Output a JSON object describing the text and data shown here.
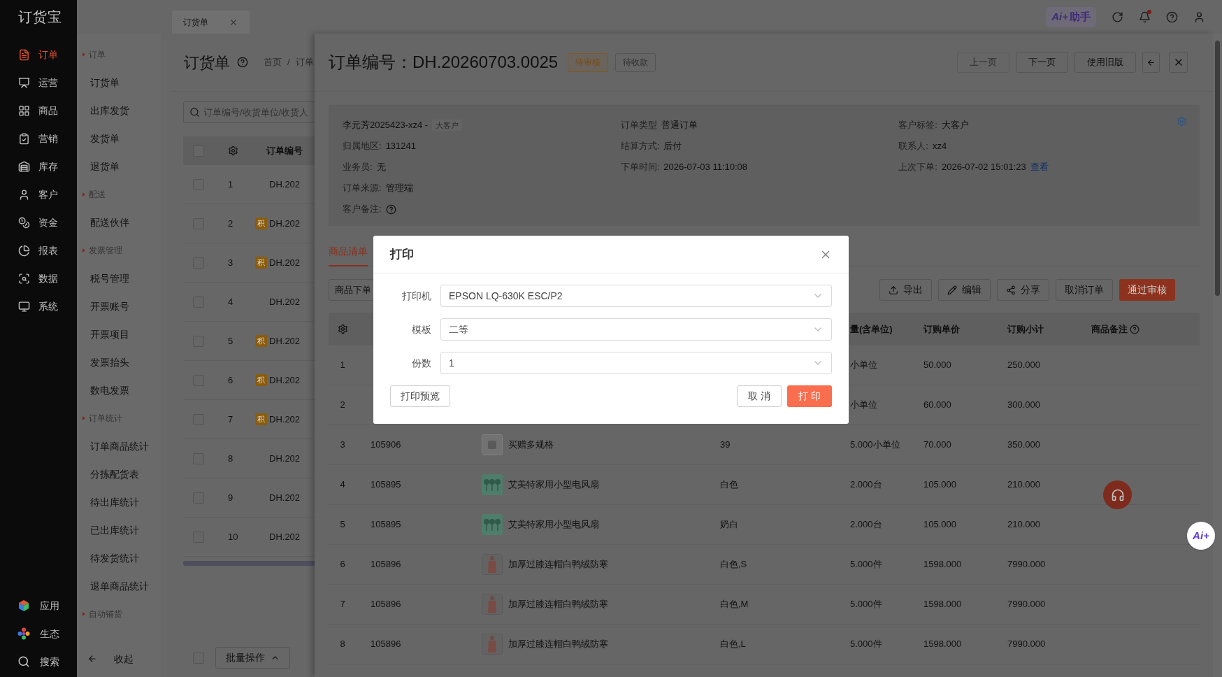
{
  "sidebar": {
    "logo": "订货宝",
    "items": [
      {
        "label": "订单",
        "selected": true
      },
      {
        "label": "运营",
        "selected": false
      },
      {
        "label": "商品",
        "selected": false
      },
      {
        "label": "营销",
        "selected": false
      },
      {
        "label": "库存",
        "selected": false
      },
      {
        "label": "客户",
        "selected": false
      },
      {
        "label": "资金",
        "selected": false
      },
      {
        "label": "报表",
        "selected": false
      },
      {
        "label": "数据",
        "selected": false
      },
      {
        "label": "系统",
        "selected": false
      }
    ],
    "bottom_items": [
      {
        "label": "应用"
      },
      {
        "label": "生态"
      },
      {
        "label": "搜索"
      }
    ]
  },
  "submenu": {
    "items": [
      {
        "kind": "group",
        "label": "订单"
      },
      {
        "kind": "link",
        "label": "订货单"
      },
      {
        "kind": "link",
        "label": "出库发货"
      },
      {
        "kind": "link",
        "label": "发货单"
      },
      {
        "kind": "link",
        "label": "退货单"
      },
      {
        "kind": "group",
        "label": "配送"
      },
      {
        "kind": "link",
        "label": "配送伙伴"
      },
      {
        "kind": "group",
        "label": "发票管理"
      },
      {
        "kind": "link",
        "label": "税号管理"
      },
      {
        "kind": "link",
        "label": "开票账号"
      },
      {
        "kind": "link",
        "label": "开票项目"
      },
      {
        "kind": "link",
        "label": "发票抬头"
      },
      {
        "kind": "link",
        "label": "数电发票"
      },
      {
        "kind": "group",
        "label": "订单统计"
      },
      {
        "kind": "link",
        "label": "订单商品统计"
      },
      {
        "kind": "link",
        "label": "分拣配货表"
      },
      {
        "kind": "link",
        "label": "待出库统计"
      },
      {
        "kind": "link",
        "label": "已出库统计"
      },
      {
        "kind": "link",
        "label": "待发货统计"
      },
      {
        "kind": "link",
        "label": "退单商品统计"
      },
      {
        "kind": "group",
        "label": "自动铺货"
      }
    ],
    "collapse": "收起"
  },
  "topbar": {
    "tabs": [
      {
        "label": "订货单",
        "selected": true
      }
    ],
    "assistant": {
      "logo": "Ai+",
      "label": "助手"
    },
    "notifications": {
      "unread": true
    }
  },
  "list_page": {
    "title": "订货单",
    "breadcrumb": {
      "items": [
        "首页",
        "订单"
      ],
      "separator": "/"
    },
    "search": {
      "placeholder": "订单编号/收货单位/收货人"
    },
    "header_checked": false,
    "column": "订单编号",
    "rows": [
      {
        "index": "1",
        "order": "DH.202",
        "checked": false
      },
      {
        "index": "2",
        "badge": "积",
        "order": "DH.202",
        "checked": false
      },
      {
        "index": "3",
        "badge": "积",
        "order": "DH.202",
        "checked": false
      },
      {
        "index": "4",
        "order": "DH.202",
        "checked": false
      },
      {
        "index": "5",
        "badge": "积",
        "order": "DH.202",
        "checked": false
      },
      {
        "index": "6",
        "badge": "积",
        "order": "DH.202",
        "checked": false
      },
      {
        "index": "7",
        "badge": "积",
        "order": "DH.202",
        "checked": false
      },
      {
        "index": "8",
        "order": "DH.202",
        "checked": false
      },
      {
        "index": "9",
        "order": "DH.202",
        "checked": false
      },
      {
        "index": "10",
        "order": "DH.202",
        "checked": false
      }
    ],
    "footer_checked": false,
    "batch": "批量操作"
  },
  "drawer": {
    "title": "订单编号：DH.20260703.0025",
    "tags": [
      {
        "label": "待审核",
        "kind": "warning"
      },
      {
        "label": "待收款",
        "kind": "plain"
      }
    ],
    "nav": [
      {
        "label": "上一页",
        "disabled": true
      },
      {
        "label": "下一页",
        "disabled": false
      },
      {
        "label": "使用旧版",
        "disabled": false
      }
    ],
    "customer": {
      "name": "李元芳2025423-xz4 -",
      "tag": "大客户"
    },
    "info_columns": [
      [
        {
          "label": "归属地区:",
          "value": "131241"
        },
        {
          "label": "业务员:",
          "value": "无"
        },
        {
          "label": "订单来源:",
          "value": "管理端"
        },
        {
          "label": "客户备注:",
          "kind": "help"
        }
      ],
      [
        {
          "label": "订单类型",
          "value": "普通订单"
        },
        {
          "label": "结算方式:",
          "value": "后付"
        },
        {
          "label": "下单时间:",
          "value": "2026-07-03 11:10:08"
        }
      ],
      [
        {
          "label": "客户标签:",
          "value": "大客户"
        },
        {
          "label": "联系人:",
          "value": "xz4"
        },
        {
          "label": "上次下单:",
          "value": "2026-07-02 15:01:23",
          "link": "查看"
        }
      ]
    ],
    "tabs": [
      {
        "label": "商品清单",
        "selected": true
      }
    ],
    "toolbar": [
      {
        "label": "商品下单",
        "kind": "plain"
      },
      {
        "label": "导出",
        "kind": "export"
      },
      {
        "label": "编辑",
        "kind": "edit"
      },
      {
        "label": "分享",
        "kind": "share"
      },
      {
        "label": "取消订单",
        "kind": "plain"
      },
      {
        "label": "通过审核",
        "kind": "primary"
      }
    ],
    "columns": {
      "quantity": "量(含单位)",
      "price": "订购单价",
      "subtotal": "订购小计",
      "note": "商品备注"
    },
    "rows": [
      {
        "index": "1",
        "kind": "covered",
        "quantity": "小单位",
        "price": "50.000",
        "subtotal": "250.000"
      },
      {
        "index": "2",
        "kind": "covered",
        "quantity": "小单位",
        "price": "60.000",
        "subtotal": "300.000"
      },
      {
        "index": "3",
        "code": "105906",
        "kind": "blank",
        "name": "买赠多规格",
        "spec": "39",
        "quantity": "5.000小单位",
        "price": "70.000",
        "subtotal": "350.000"
      },
      {
        "index": "4",
        "code": "105895",
        "kind": "fan",
        "name": "艾美特家用小型电风扇",
        "spec": "白色",
        "quantity": "2.000台",
        "price": "105.000",
        "subtotal": "210.000"
      },
      {
        "index": "5",
        "code": "105895",
        "kind": "fan",
        "name": "艾美特家用小型电风扇",
        "spec": "奶白",
        "quantity": "2.000台",
        "price": "105.000",
        "subtotal": "210.000"
      },
      {
        "index": "6",
        "code": "105896",
        "kind": "coat",
        "name": "加厚过膝连帽白鸭绒防寒",
        "spec": "白色,S",
        "quantity": "5.000件",
        "price": "1598.000",
        "subtotal": "7990.000"
      },
      {
        "index": "7",
        "code": "105896",
        "kind": "coat",
        "name": "加厚过膝连帽白鸭绒防寒",
        "spec": "白色,M",
        "quantity": "5.000件",
        "price": "1598.000",
        "subtotal": "7990.000"
      },
      {
        "index": "8",
        "code": "105896",
        "kind": "coat",
        "name": "加厚过膝连帽白鸭绒防寒",
        "spec": "白色,L",
        "quantity": "5.000件",
        "price": "1598.000",
        "subtotal": "7990.000"
      }
    ]
  },
  "float_assistant": {
    "logo": "Ai+"
  },
  "dialog": {
    "title": "打印",
    "fields": [
      {
        "label": "打印机",
        "value": "EPSON LQ-630K ESC/P2"
      },
      {
        "label": "模板",
        "value": "二等"
      },
      {
        "label": "份数",
        "value": "1"
      }
    ],
    "preview": "打印预览",
    "cancel": "取 消",
    "confirm": "打 印"
  }
}
